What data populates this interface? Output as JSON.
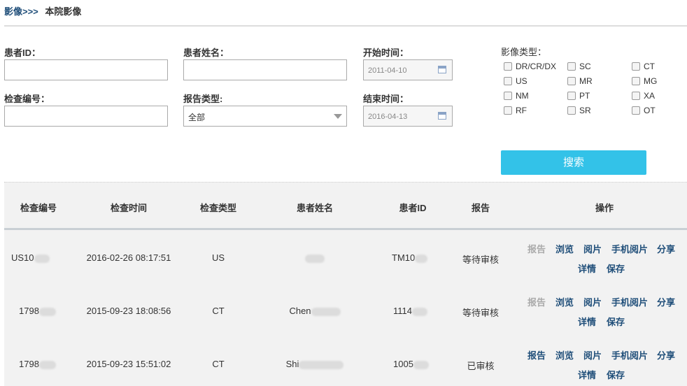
{
  "breadcrumb": {
    "root": "影像>>>",
    "current": "本院影像"
  },
  "form": {
    "patient_id_label": "患者ID：",
    "patient_name_label": "患者姓名：",
    "start_time_label": "开始时间：",
    "start_time_value": "2011-04-10",
    "exam_no_label": "检查编号：",
    "report_type_label": "报告类型:",
    "report_type_value": "全部",
    "end_time_label": "结束时间：",
    "end_time_value": "2016-04-13",
    "modality_label": "影像类型：",
    "modalities": [
      "DR/CR/DX",
      "SC",
      "CT",
      "US",
      "MR",
      "MG",
      "NM",
      "PT",
      "XA",
      "RF",
      "SR",
      "OT"
    ],
    "search_label": "搜索"
  },
  "table": {
    "headers": [
      "检查编号",
      "检查时间",
      "检查类型",
      "患者姓名",
      "患者ID",
      "报告",
      "操作"
    ],
    "rows": [
      {
        "exam_no": "US10",
        "time": "2016-02-26 08:17:51",
        "type": "US",
        "name": "",
        "pid": "TM10",
        "report": "等待审核",
        "report_enabled": false
      },
      {
        "exam_no": "1798",
        "time": "2015-09-23 18:08:56",
        "type": "CT",
        "name": "Chen",
        "pid": "1114",
        "report": "等待审核",
        "report_enabled": false
      },
      {
        "exam_no": "1798",
        "time": "2015-09-23 15:51:02",
        "type": "CT",
        "name": "Shi",
        "pid": "1005",
        "report": "已审核",
        "report_enabled": true
      }
    ],
    "actions": {
      "report": "报告",
      "browse": "浏览",
      "read": "阅片",
      "mobile_read": "手机阅片",
      "share": "分享",
      "detail": "详情",
      "save": "保存"
    }
  },
  "colors": {
    "accent": "#33c2e8",
    "link": "#1f4e79",
    "disabled": "#aaaaaa"
  }
}
